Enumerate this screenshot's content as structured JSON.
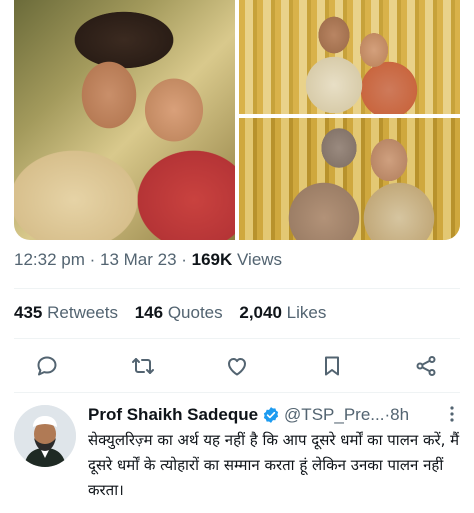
{
  "tweet": {
    "media": [
      "photo",
      "photo",
      "photo"
    ],
    "timestamp": "12:32 pm · 13 Mar 23 · ",
    "views_count": "169K",
    "views_label": " Views",
    "stats": {
      "retweets": {
        "count": "435",
        "label": "Retweets"
      },
      "quotes": {
        "count": "146",
        "label": "Quotes"
      },
      "likes": {
        "count": "2,040",
        "label": "Likes"
      }
    },
    "actions": [
      "reply-icon",
      "retweet-icon",
      "like-icon",
      "bookmark-icon",
      "share-icon"
    ]
  },
  "reply": {
    "author_name": "Prof Shaikh Sadeque",
    "handle": "@TSP_Pre...",
    "separator": " · ",
    "time": "8h",
    "text": "सेक्युलरिज़्म का अर्थ यह नहीं है कि आप दूसरे धर्मों का पालन करें, मैं दूसरे धर्मों के त्योहारों का सम्मान करता हूं लेकिन उनका पालन नहीं करता।"
  },
  "colors": {
    "text_primary": "#0f1419",
    "text_secondary": "#536471",
    "verified_blue": "#1d9bf0",
    "divider": "#eff3f4"
  }
}
